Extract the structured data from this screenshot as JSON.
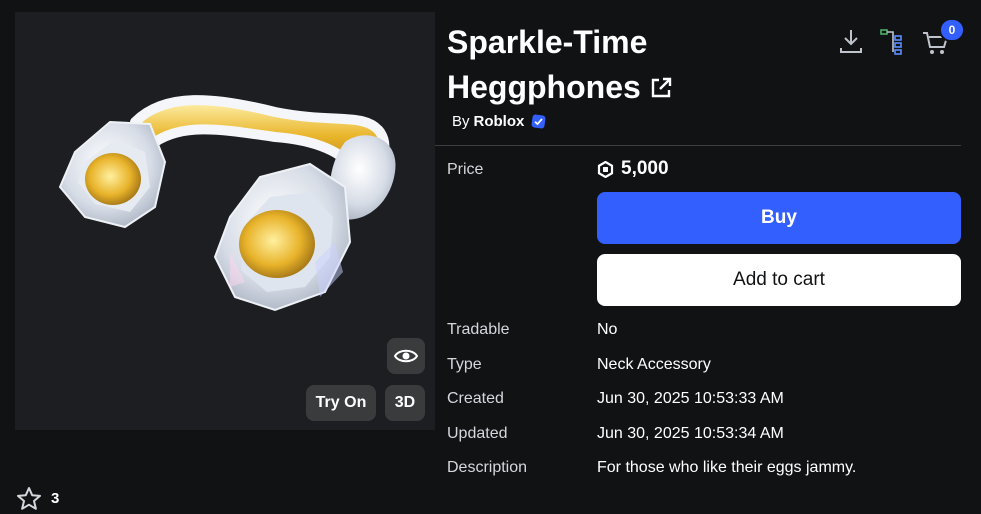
{
  "item": {
    "title": "Sparkle-Time Heggphones",
    "by_prefix": "By",
    "creator": "Roblox"
  },
  "header": {
    "cart_count": "0"
  },
  "preview": {
    "try_on_label": "Try On",
    "three_d_label": "3D"
  },
  "favorites": {
    "count": "3"
  },
  "price": {
    "label": "Price",
    "amount": "5,000"
  },
  "actions": {
    "buy_label": "Buy",
    "add_to_cart_label": "Add to cart"
  },
  "details": [
    {
      "label": "Tradable",
      "value": "No"
    },
    {
      "label": "Type",
      "value": "Neck Accessory"
    },
    {
      "label": "Created",
      "value": "Jun 30, 2025 10:53:33 AM"
    },
    {
      "label": "Updated",
      "value": "Jun 30, 2025 10:53:34 AM"
    },
    {
      "label": "Description",
      "value": "For those who like their eggs jammy."
    }
  ],
  "colors": {
    "background": "#111214",
    "panel": "#1d1e22",
    "primary": "#335fff",
    "button_dark": "#393b3d",
    "verified": "#335fff"
  },
  "icons": [
    "external-link-icon",
    "verified-badge-icon",
    "download-icon",
    "hierarchy-icon",
    "cart-icon",
    "robux-icon",
    "eye-icon",
    "star-icon"
  ]
}
